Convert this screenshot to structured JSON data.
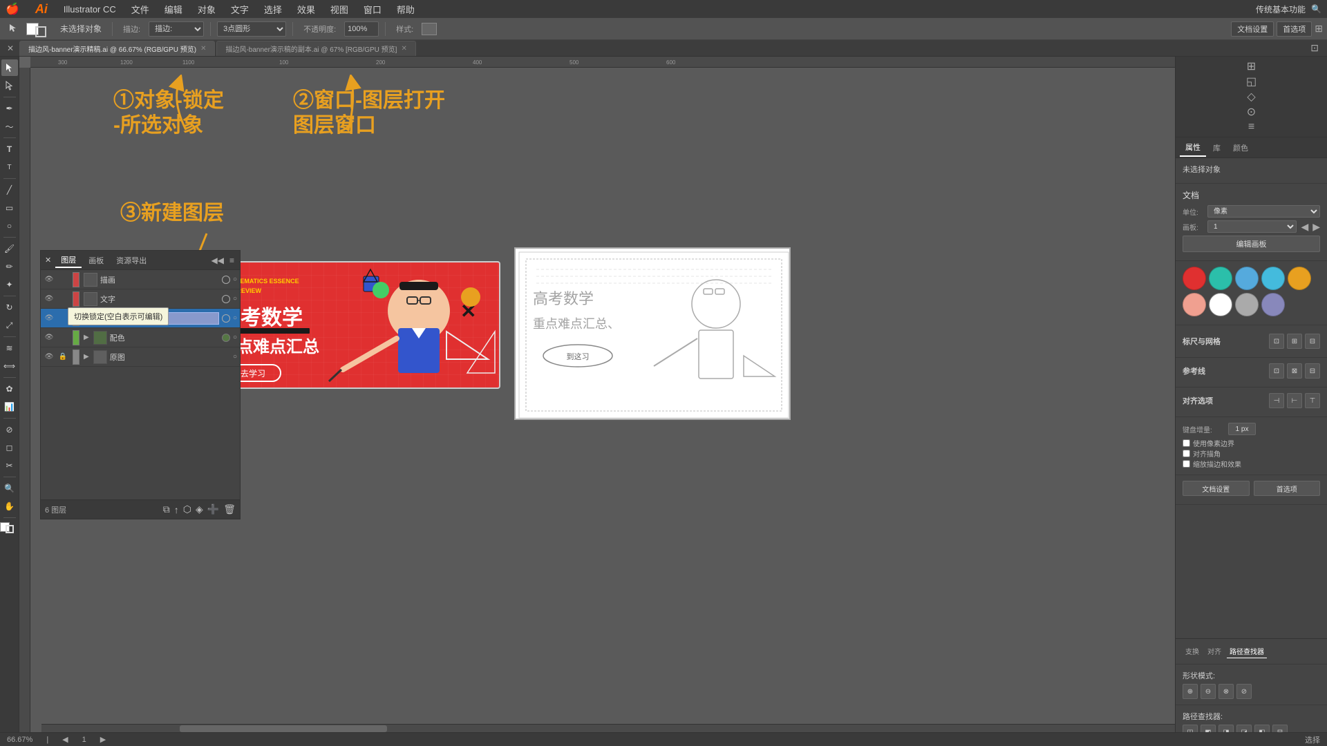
{
  "app": {
    "title": "Illustrator CC",
    "logo": "Ai"
  },
  "menubar": {
    "apple": "🍎",
    "items": [
      "Illustrator CC",
      "文件",
      "编辑",
      "对象",
      "文字",
      "选择",
      "效果",
      "视图",
      "窗口",
      "帮助"
    ],
    "right": "传统基本功能"
  },
  "toolbar": {
    "no_selection": "未选择对象",
    "stroke": "描边:",
    "shape": "3点圆形",
    "opacity_label": "不透明度:",
    "opacity_value": "100%",
    "style_label": "样式:",
    "doc_settings": "文档设置",
    "preferences": "首选项"
  },
  "tabs": [
    {
      "label": "描边风-banner演示精稿.ai @ 66.67% (RGB/GPU 预览)",
      "active": true
    },
    {
      "label": "描边风-banner演示稿的副本.ai @ 67% [RGB/GPU 预览]",
      "active": false
    }
  ],
  "annotations": {
    "step1": "①对象-锁定",
    "step1b": "-所选对象",
    "step2": "②窗口-图层打开",
    "step2b": "图层窗口",
    "step3": "③新建图层"
  },
  "layers_panel": {
    "tabs": [
      "图层",
      "画板",
      "资源导出"
    ],
    "layers": [
      {
        "name": "描画",
        "visible": true,
        "locked": false,
        "color": "#cc4444",
        "target": true
      },
      {
        "name": "文字",
        "visible": true,
        "locked": false,
        "color": "#cc4444",
        "target": true
      },
      {
        "name": "",
        "visible": true,
        "locked": false,
        "color": "#4477cc",
        "editing": true,
        "target": true
      },
      {
        "name": "配色",
        "visible": true,
        "locked": false,
        "color": "#66aa44",
        "expanded": true,
        "target": false
      },
      {
        "name": "原图",
        "visible": true,
        "locked": true,
        "color": "#888888",
        "target": false
      }
    ],
    "layer_count": "6 图层",
    "tooltip": "切换锁定(空白表示可编辑)"
  },
  "right_panel": {
    "tabs": [
      "属性",
      "库",
      "颜色"
    ],
    "no_selection": "未选择对象",
    "doc_section": "文档",
    "unit_label": "单位:",
    "unit_value": "像素",
    "page_label": "画板:",
    "page_value": "1",
    "edit_artboard_btn": "编辑画板",
    "sections": {
      "ruler_grid": "标尺与网格",
      "guides": "参考线",
      "snap": "对齐选项",
      "prefs": "首选项"
    },
    "keyboard_increment": "键盘增量:",
    "keyboard_value": "1 px",
    "snap_to_pixel": "使用像素边界",
    "snap_corners": "对齐描角",
    "scale_strokes": "缩放描边和效果",
    "quick_actions": {
      "doc_settings": "文档设置",
      "preferences": "首选项"
    },
    "color_swatches": [
      "#e03030",
      "#2bbfaa",
      "#55aadd",
      "#44bbdd",
      "#e8a020",
      "#f0a090",
      "#ffffff",
      "#aaaaaa",
      "#8888bb"
    ],
    "path_finder_title": "路径查找器",
    "shape_mode_title": "形状模式:",
    "path_finder_label": "路径查找器:"
  },
  "statusbar": {
    "zoom": "66.67%",
    "tool": "选择"
  }
}
